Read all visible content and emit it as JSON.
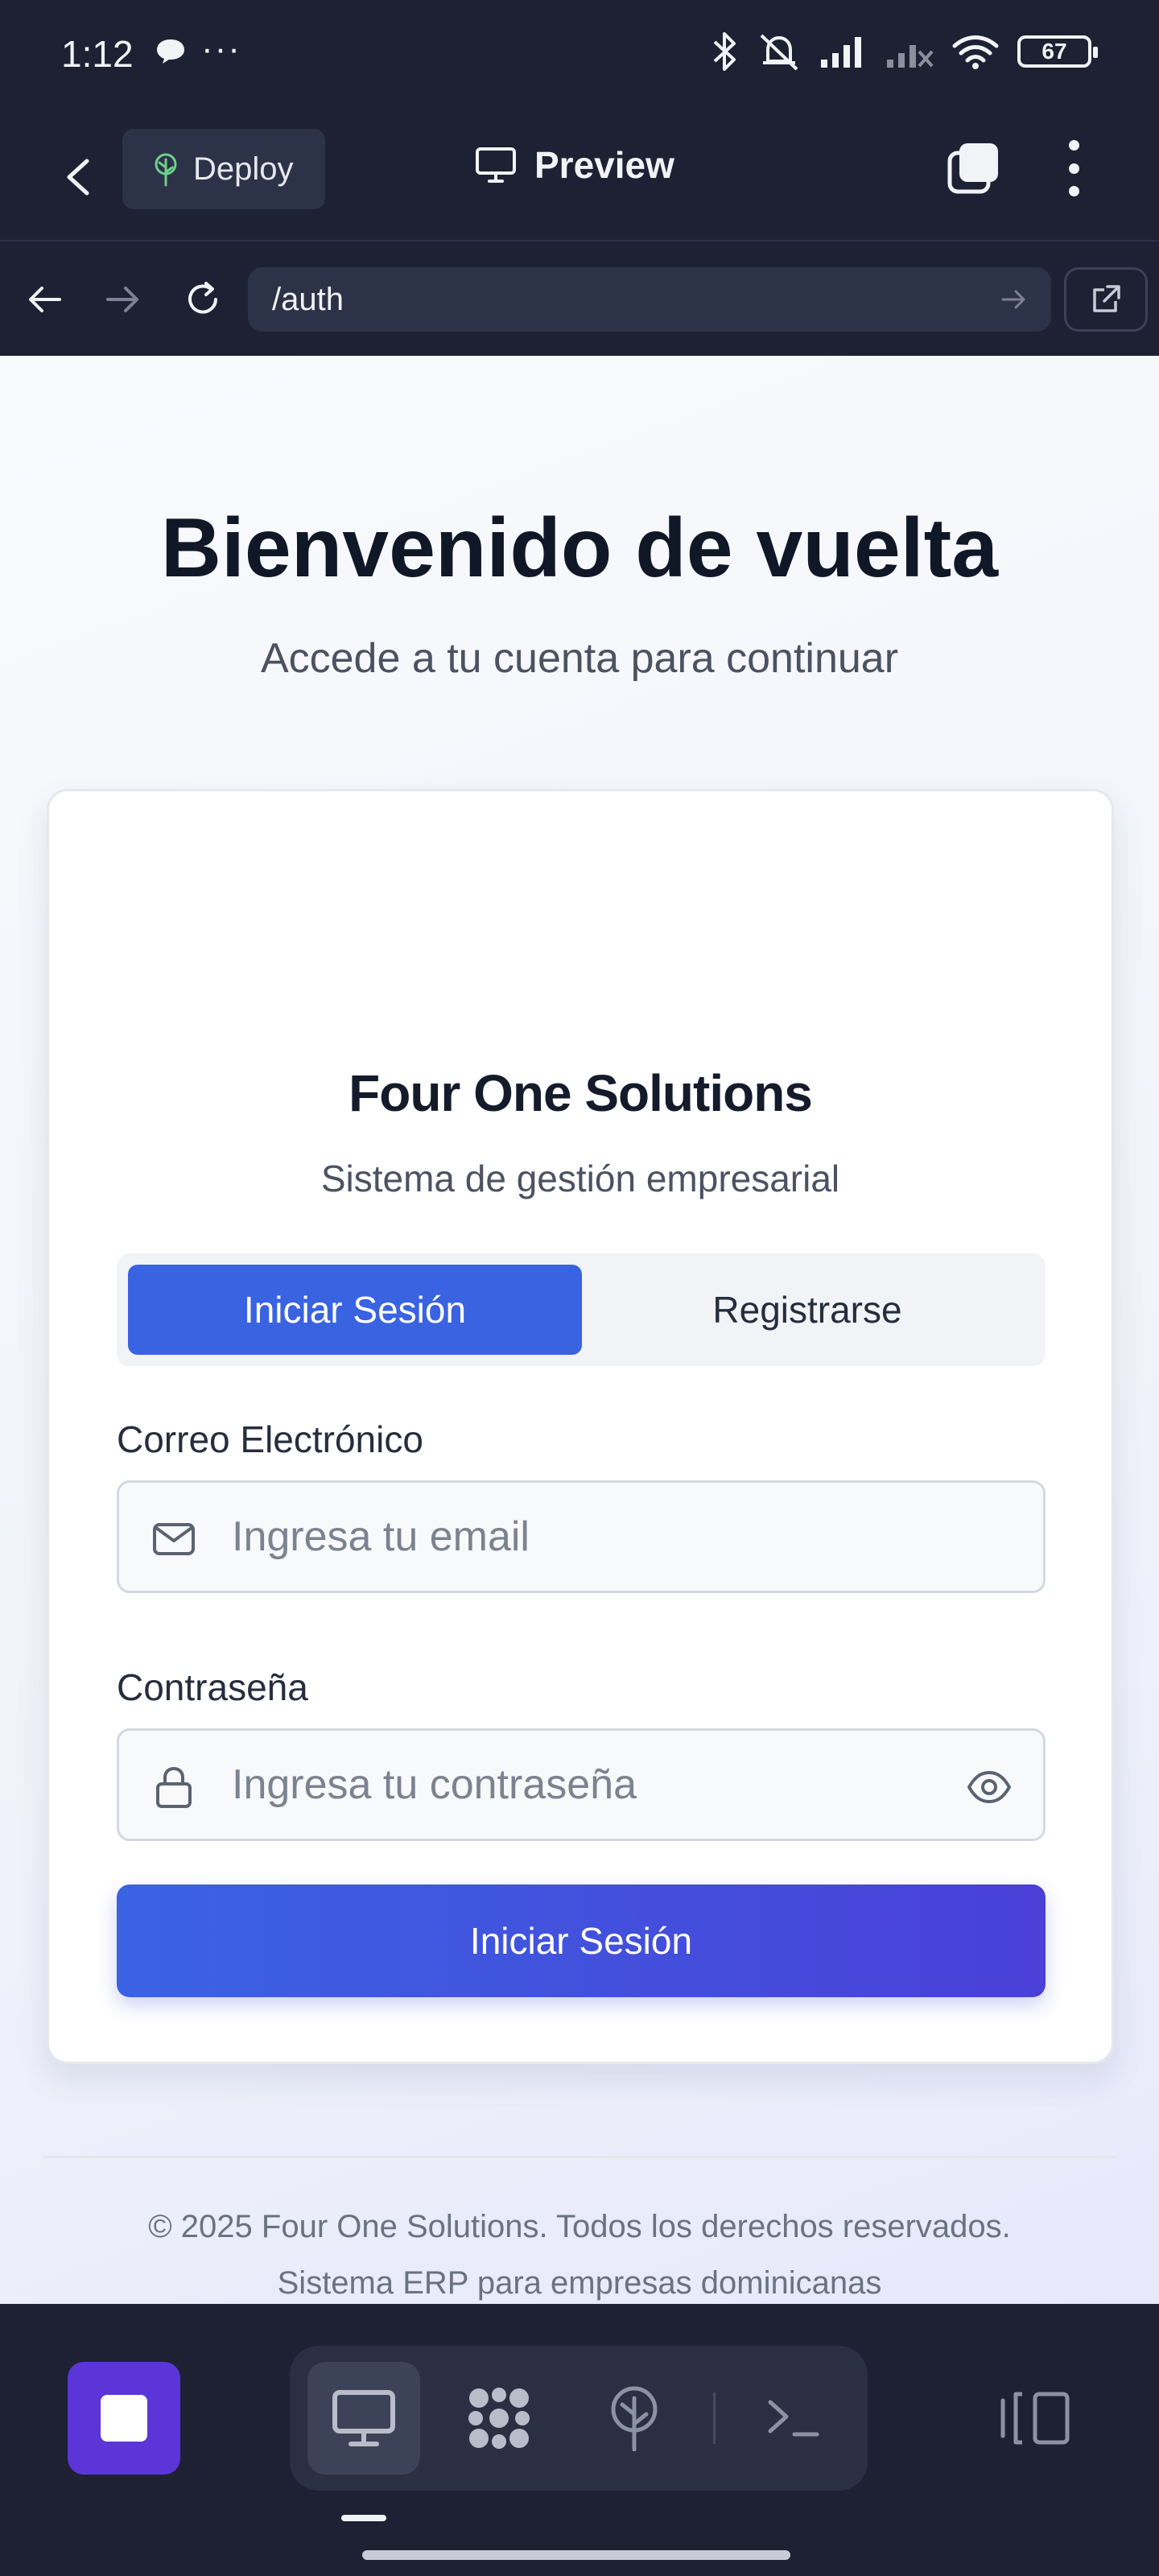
{
  "status_bar": {
    "time": "1:12",
    "more": "···",
    "battery": "67"
  },
  "app_header": {
    "deploy_label": "Deploy",
    "preview_label": "Preview"
  },
  "url_bar": {
    "url": "/auth"
  },
  "page": {
    "title": "Bienvenido de vuelta",
    "subtitle": "Accede a tu cuenta para continuar",
    "card": {
      "brand_name": "Four One Solutions",
      "brand_subtitle": "Sistema de gestión empresarial",
      "tabs": [
        {
          "label": "Iniciar Sesión",
          "active": true
        },
        {
          "label": "Registrarse",
          "active": false
        }
      ],
      "email": {
        "label": "Correo Electrónico",
        "placeholder": "Ingresa tu email"
      },
      "password": {
        "label": "Contraseña",
        "placeholder": "Ingresa tu contraseña"
      },
      "submit_label": "Iniciar Sesión"
    },
    "footer": {
      "copyright": "© 2025 Four One Solutions. Todos los derechos reservados.",
      "tagline": "Sistema ERP para empresas dominicanas"
    }
  },
  "colors": {
    "primary": "#3a63e2",
    "primary_end": "#4a40d8",
    "stop_button": "#5b35d8",
    "chrome_bg": "#1d2133"
  },
  "icons": {
    "status": [
      "chat-bubble-icon",
      "bluetooth-icon",
      "mute-icon",
      "signal-icon",
      "wifi-icon",
      "battery-icon"
    ],
    "header": [
      "back-chevron-icon",
      "deploy-tree-icon",
      "monitor-icon",
      "tabs-icon",
      "kebab-menu-icon"
    ],
    "url_bar": [
      "arrow-left-icon",
      "arrow-right-icon",
      "reload-icon",
      "go-arrow-icon",
      "open-external-icon"
    ],
    "form": [
      "mail-icon",
      "lock-icon",
      "eye-icon"
    ],
    "toolbar": [
      "stop-icon",
      "monitor-icon",
      "grid-blob-icon",
      "deploy-tree-icon",
      "terminal-icon",
      "panel-toggle-icon"
    ]
  }
}
